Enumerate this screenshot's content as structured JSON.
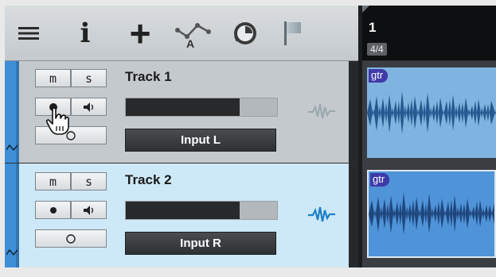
{
  "toolbar": {
    "icons": [
      "menu-icon",
      "info-icon",
      "add-icon",
      "automation-icon",
      "timing-icon",
      "marker-flag-icon"
    ],
    "info_glyph": "i",
    "add_glyph": "+",
    "automation_letter": "A"
  },
  "ruler": {
    "bar": "1",
    "time_signature": "4/4"
  },
  "tracks": [
    {
      "name": "Track 1",
      "mute_label": "m",
      "solo_label": "s",
      "record_armed": true,
      "meter_level": 0.75,
      "input": "Input L",
      "event_label": "gtr",
      "lane_color": "#3f8fd8"
    },
    {
      "name": "Track 2",
      "mute_label": "m",
      "solo_label": "s",
      "record_armed": false,
      "meter_level": 0.75,
      "input": "Input R",
      "event_label": "gtr",
      "lane_color": "#3f8fd8"
    }
  ],
  "colors": {
    "selected_track_bg": "#cde8f6",
    "track_bg": "#c3c9cd",
    "event_light": "#7fb4e0",
    "event_dark": "#4f93d8",
    "event_label_bg": "#3f3aa8",
    "monitor_active": "#1f80c8"
  }
}
